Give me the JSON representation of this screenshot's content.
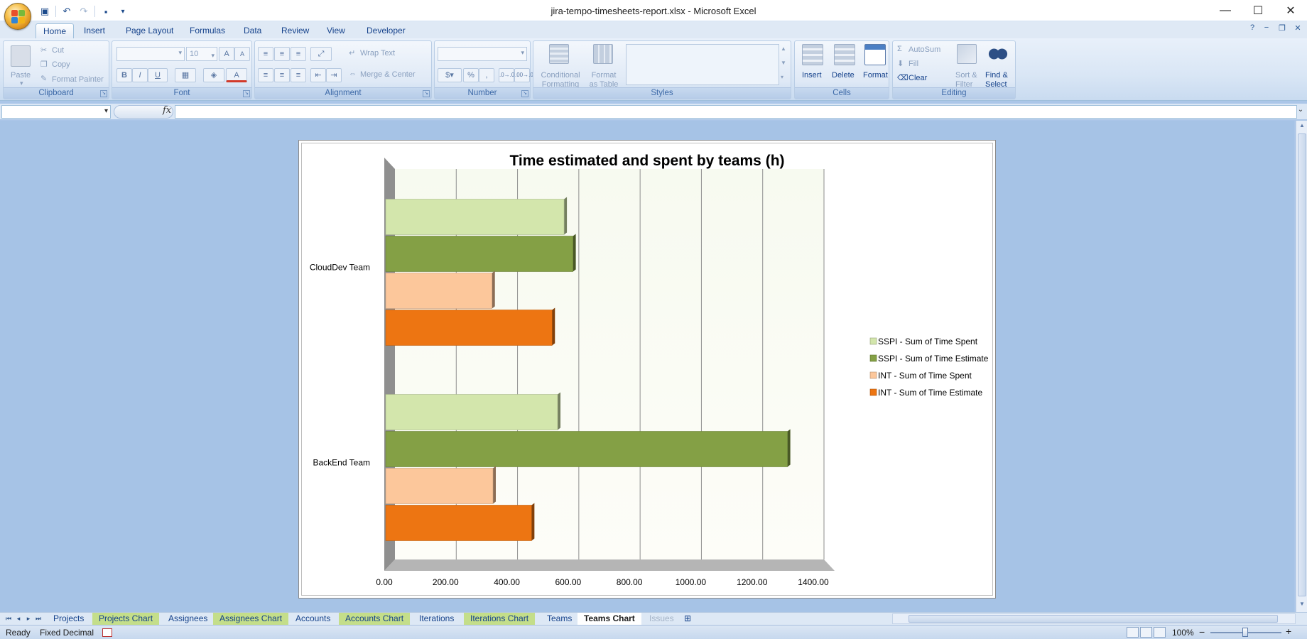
{
  "window": {
    "title": "jira-tempo-timesheets-report.xlsx - Microsoft Excel",
    "minimize": "—",
    "maximize": "☐",
    "close": "✕"
  },
  "ribbon_tabs": [
    "Home",
    "Insert",
    "Page Layout",
    "Formulas",
    "Data",
    "Review",
    "View",
    "Developer"
  ],
  "active_tab": "Home",
  "ribbon": {
    "clipboard": {
      "title": "Clipboard",
      "paste": "Paste",
      "cut": "Cut",
      "copy": "Copy",
      "format_painter": "Format Painter"
    },
    "font": {
      "title": "Font",
      "font_name": "",
      "font_size": "10",
      "bold": "B",
      "italic": "I",
      "underline": "U",
      "grow": "A",
      "shrink": "A",
      "font_color": "A"
    },
    "alignment": {
      "title": "Alignment",
      "wrap_text": "Wrap Text",
      "merge_center": "Merge & Center"
    },
    "number": {
      "title": "Number",
      "format": "",
      "percent": "%",
      "comma": ",",
      "inc_dec": ".0→.00",
      "dec_dec": ".00→.0"
    },
    "styles": {
      "title": "Styles",
      "conditional_1": "Conditional",
      "conditional_2": "Formatting",
      "format_as_table_1": "Format",
      "format_as_table_2": "as Table"
    },
    "cells": {
      "title": "Cells",
      "insert": "Insert",
      "delete": "Delete",
      "format": "Format"
    },
    "editing": {
      "title": "Editing",
      "autosum": "AutoSum",
      "fill": "Fill",
      "clear": "Clear",
      "sort_1": "Sort &",
      "sort_2": "Filter",
      "find_1": "Find &",
      "find_2": "Select"
    }
  },
  "formula_bar": {
    "name_box": "",
    "fx": "fx",
    "formula": ""
  },
  "chart_data": {
    "type": "bar",
    "orientation": "horizontal",
    "title": "Time estimated and spent by teams (h)",
    "categories": [
      "BackEnd Team",
      "CloudDev Team"
    ],
    "series": [
      {
        "name": "SSPI - Sum of Time Spent",
        "color": "#d3e6ac",
        "values": [
          561,
          582
        ]
      },
      {
        "name": "SSPI - Sum of Time Estimate",
        "color": "#84a045",
        "values": [
          1311,
          611
        ]
      },
      {
        "name": "INT - Sum of Time Spent",
        "color": "#fcc79b",
        "values": [
          350,
          347
        ]
      },
      {
        "name": "INT - Sum of Time Estimate",
        "color": "#ed7512",
        "values": [
          476,
          543
        ]
      }
    ],
    "xlim": [
      0,
      1400
    ],
    "x_ticks": [
      0,
      200,
      400,
      600,
      800,
      1000,
      1200,
      1400
    ],
    "x_tick_labels": [
      "0.00",
      "200.00",
      "400.00",
      "600.00",
      "800.00",
      "1000.00",
      "1200.00",
      "1400.00"
    ],
    "grid": true,
    "legend": "right"
  },
  "sheets": [
    {
      "name": "Projects",
      "style": "normal"
    },
    {
      "name": "Projects Chart",
      "style": "green"
    },
    {
      "name": "Assignees",
      "style": "normal"
    },
    {
      "name": "Assignees Chart",
      "style": "green"
    },
    {
      "name": "Accounts",
      "style": "normal"
    },
    {
      "name": "Accounts Chart",
      "style": "green"
    },
    {
      "name": "Iterations",
      "style": "normal"
    },
    {
      "name": "Iterations Chart",
      "style": "green"
    },
    {
      "name": "Teams",
      "style": "normal"
    },
    {
      "name": "Teams Chart",
      "style": "active"
    },
    {
      "name": "Issues",
      "style": "gray"
    }
  ],
  "status": {
    "ready": "Ready",
    "fixed_decimal": "Fixed Decimal",
    "zoom": "100%",
    "zoom_minus": "−",
    "zoom_plus": "+"
  }
}
